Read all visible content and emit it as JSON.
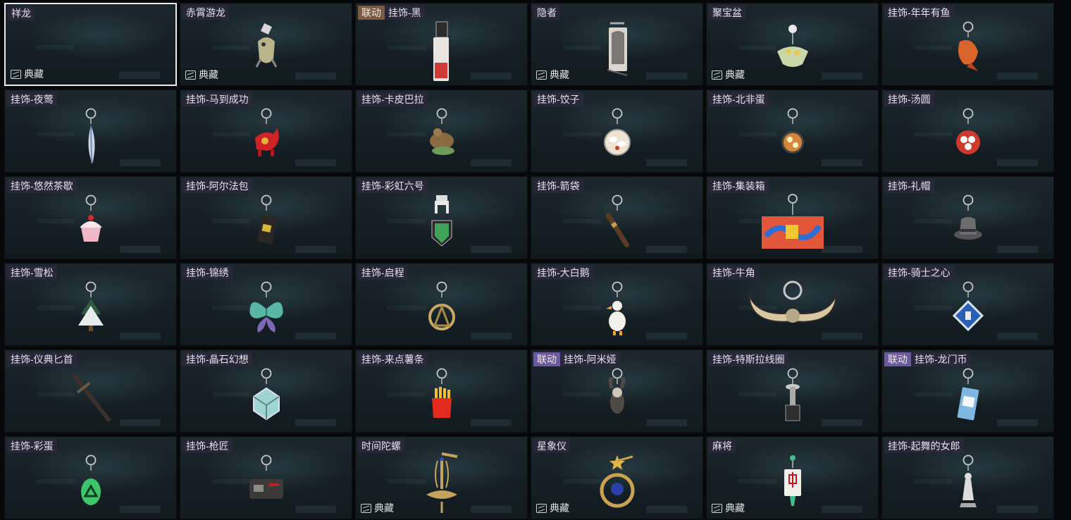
{
  "items": [
    {
      "name": "祥龙",
      "collab": "",
      "collect": "典藏",
      "selected": true,
      "icon": "empty",
      "color": "#000000"
    },
    {
      "name": "赤霄游龙",
      "collab": "",
      "collect": "典藏",
      "icon": "dragon-figure-icon",
      "color": "#b9b48a"
    },
    {
      "name": "挂饰-黑",
      "collab": "联动",
      "collect": "",
      "icon": "tag-charm-icon",
      "color": "#e8e4df"
    },
    {
      "name": "隐者",
      "collab": "",
      "collect": "典藏",
      "icon": "hermit-card-icon",
      "color": "#7b7774"
    },
    {
      "name": "聚宝盆",
      "collab": "",
      "collect": "典藏",
      "icon": "treasure-bowl-icon",
      "color": "#c9d8a8"
    },
    {
      "name": "挂饰-年年有鱼",
      "collab": "",
      "collect": "",
      "icon": "fish-icon",
      "color": "#d9642c"
    },
    {
      "name": "挂饰-夜莺",
      "collab": "",
      "collect": "",
      "icon": "feather-icon",
      "color": "#c9d4e4"
    },
    {
      "name": "挂饰-马到成功",
      "collab": "",
      "collect": "",
      "icon": "horse-icon",
      "color": "#cf2326"
    },
    {
      "name": "挂饰-卡皮巴拉",
      "collab": "",
      "collect": "",
      "icon": "capybara-icon",
      "color": "#8a6a3f"
    },
    {
      "name": "挂饰-饺子",
      "collab": "",
      "collect": "",
      "icon": "dumpling-plate-icon",
      "color": "#efe3d2"
    },
    {
      "name": "挂饰-北非蛋",
      "collab": "",
      "collect": "",
      "icon": "shakshuka-pan-icon",
      "color": "#d7863a"
    },
    {
      "name": "挂饰-汤圆",
      "collab": "",
      "collect": "",
      "icon": "tangyuan-bowl-icon",
      "color": "#d0382c"
    },
    {
      "name": "挂饰-悠然茶歇",
      "collab": "",
      "collect": "",
      "icon": "cupcake-icon",
      "color": "#efb7c7"
    },
    {
      "name": "挂饰-阿尔法包",
      "collab": "",
      "collect": "",
      "icon": "bag-icon",
      "color": "#2a2623"
    },
    {
      "name": "挂饰-彩虹六号",
      "collab": "",
      "collect": "",
      "icon": "rainbow-six-icon",
      "color": "#3fa35a"
    },
    {
      "name": "挂饰-箭袋",
      "collab": "",
      "collect": "",
      "icon": "quiver-icon",
      "color": "#5b3a23"
    },
    {
      "name": "挂饰-集装箱",
      "collab": "",
      "collect": "",
      "icon": "container-icon",
      "color": "#e2563a"
    },
    {
      "name": "挂饰-礼帽",
      "collab": "",
      "collect": "",
      "icon": "top-hat-icon",
      "color": "#6d6d6f"
    },
    {
      "name": "挂饰-雪松",
      "collab": "",
      "collect": "",
      "icon": "pine-tree-icon",
      "color": "#e6eceb"
    },
    {
      "name": "挂饰-锦绣",
      "collab": "",
      "collect": "",
      "icon": "butterfly-icon",
      "color": "#5ab7a6"
    },
    {
      "name": "挂饰-启程",
      "collab": "",
      "collect": "",
      "icon": "compass-ring-icon",
      "color": "#c7a964"
    },
    {
      "name": "挂饰-大白鹅",
      "collab": "",
      "collect": "",
      "icon": "goose-icon",
      "color": "#f1f0ea"
    },
    {
      "name": "挂饰-牛角",
      "collab": "",
      "collect": "",
      "icon": "bull-horns-icon",
      "color": "#d9c7a1"
    },
    {
      "name": "挂饰-骑士之心",
      "collab": "",
      "collect": "",
      "icon": "knight-badge-icon",
      "color": "#2a5fb8"
    },
    {
      "name": "挂饰-仪典匕首",
      "collab": "",
      "collect": "",
      "icon": "dagger-icon",
      "color": "#3b302a"
    },
    {
      "name": "挂饰-晶石幻想",
      "collab": "",
      "collect": "",
      "icon": "crystal-cube-icon",
      "color": "#9fd5d2"
    },
    {
      "name": "挂饰-来点薯条",
      "collab": "",
      "collect": "",
      "icon": "fries-icon",
      "color": "#e42b1f"
    },
    {
      "name": "挂饰-阿米娅",
      "collab": "联动",
      "collect": "",
      "icon": "bunny-figure-icon",
      "color": "#4e4a48"
    },
    {
      "name": "挂饰-特斯拉线圈",
      "collab": "",
      "collect": "",
      "icon": "tesla-coil-icon",
      "color": "#c9c9c9"
    },
    {
      "name": "挂饰-龙门币",
      "collab": "联动",
      "collect": "",
      "icon": "coin-card-icon",
      "color": "#7fb7e0"
    },
    {
      "name": "挂饰-彩蛋",
      "collab": "",
      "collect": "",
      "icon": "egg-icon",
      "color": "#3ec56b"
    },
    {
      "name": "挂饰-枪匠",
      "collab": "",
      "collect": "",
      "icon": "gun-part-icon",
      "color": "#3c3a38"
    },
    {
      "name": "时间陀螺",
      "collab": "",
      "collect": "典藏",
      "icon": "spinning-top-icon",
      "color": "#c4a35e"
    },
    {
      "name": "星象仪",
      "collab": "",
      "collect": "典藏",
      "icon": "astrolabe-icon",
      "color": "#caa24f"
    },
    {
      "name": "麻将",
      "collab": "",
      "collect": "典藏",
      "icon": "mahjong-tile-icon",
      "color": "#f0efe9"
    },
    {
      "name": "挂饰-起舞的女郎",
      "collab": "",
      "collect": "",
      "icon": "dancer-statue-icon",
      "color": "#dcdcdc"
    }
  ]
}
